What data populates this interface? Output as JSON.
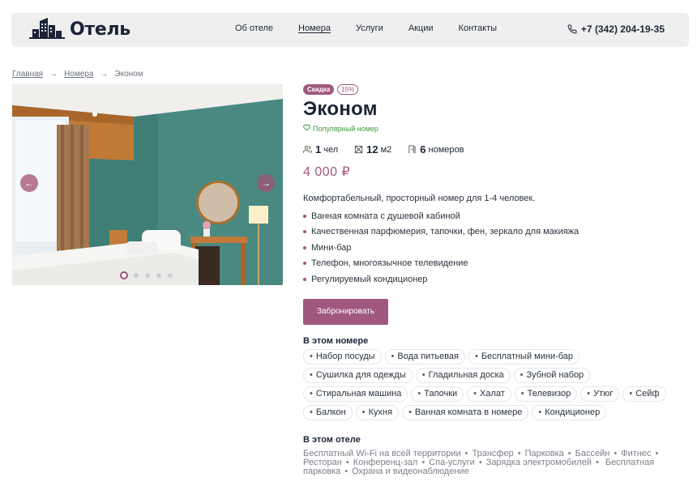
{
  "header": {
    "logo_text": "Отель",
    "nav": [
      {
        "label": "Об отеле",
        "active": false
      },
      {
        "label": "Номера",
        "active": true
      },
      {
        "label": "Услуги",
        "active": false
      },
      {
        "label": "Акции",
        "active": false
      },
      {
        "label": "Контакты",
        "active": false
      }
    ],
    "phone": "+7 (342) 204-19-35"
  },
  "breadcrumb": {
    "home": "Главная",
    "rooms": "Номера",
    "current": "Эконом"
  },
  "gallery": {
    "slide_count": 5,
    "active_slide": 1
  },
  "room": {
    "badge_sale": "Скидка",
    "badge_percent": "15%",
    "title": "Эконом",
    "popular": "Популярный номер",
    "guests_value": "1",
    "guests_unit": "чел",
    "area_value": "12",
    "area_unit": "м2",
    "rooms_value": "6",
    "rooms_unit": "номеров",
    "price": "4 000 ₽",
    "description": "Комфортабельный, просторный номер для 1-4 человек.",
    "features": [
      "Ванная комната с душевой кабиной",
      "Качественная парфюмерия, тапочки, фен, зеркало для макияжа",
      "Мини-бар",
      "Телефон, многоязычное телевидение",
      "Регулируемый кондиционер"
    ],
    "book_label": "Забронировать"
  },
  "in_room": {
    "title": "В этом номере",
    "items": [
      "Набор посуды",
      "Вода питьевая",
      "Бесплатный мини-бар",
      "Сушилка для одежды",
      "Гладильная доска",
      "Зубной набор",
      "Стиральная машина",
      "Тапочки",
      "Халат",
      "Телевизор",
      "Утюг",
      "Сейф",
      "Балкон",
      "Кухня",
      "Ванная комната в номере",
      "Кондиционер"
    ]
  },
  "in_hotel": {
    "title": "В этом отеле",
    "items": [
      "Бесплатный Wi-Fi на всей территории",
      "Трансфер",
      "Парковка",
      "Бассейн",
      "Фитнес",
      "Ресторан",
      "Конференц-зал",
      "Спа-услуги",
      "Зарядка электромобилей",
      "Бесплатная парковка",
      "Охрана и видеонаблюдение"
    ]
  },
  "colors": {
    "accent": "#a0587e",
    "popular_green": "#3a9a3a",
    "header_bg": "#efeff0"
  }
}
